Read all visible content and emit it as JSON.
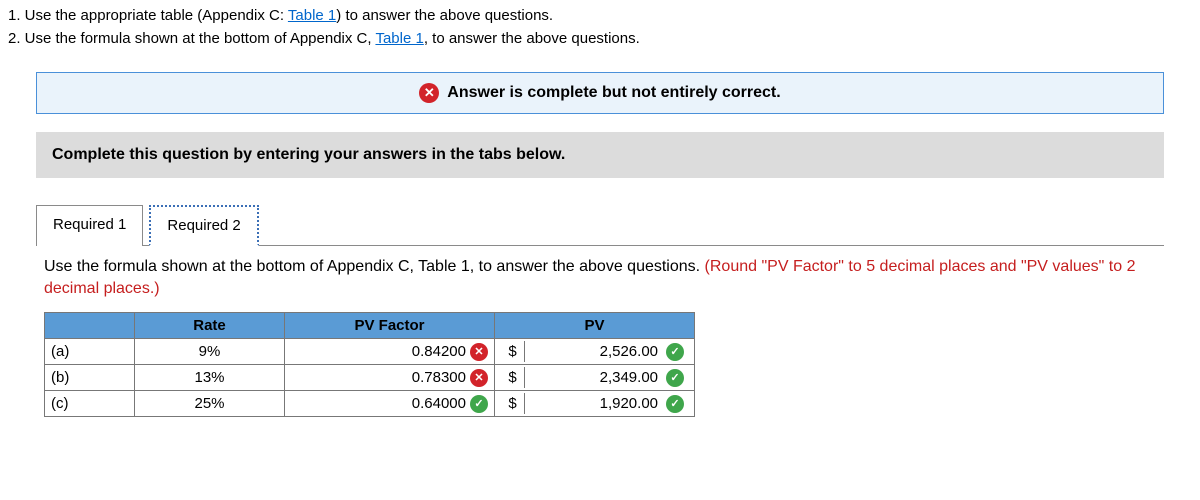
{
  "instructions": {
    "line1_prefix": "1. Use the appropriate table (Appendix C: ",
    "line1_link": "Table 1",
    "line1_suffix": ") to answer the above questions.",
    "line2_prefix": "2. Use the formula shown at the bottom of Appendix C, ",
    "line2_link": "Table 1",
    "line2_suffix": ", to answer the above questions."
  },
  "status": {
    "text": "Answer is complete but not entirely correct."
  },
  "complete_bar": "Complete this question by entering your answers in the tabs below.",
  "tabs": {
    "t1": "Required 1",
    "t2": "Required 2"
  },
  "panel": {
    "instr_main": "Use the formula shown at the bottom of Appendix C, Table 1, to answer the above questions. ",
    "instr_hint": "(Round \"PV Factor\" to 5 decimal places and \"PV values\" to 2 decimal places.)"
  },
  "table": {
    "headers": {
      "blank": "",
      "rate": "Rate",
      "pvf": "PV Factor",
      "pv": "PV"
    },
    "rows": [
      {
        "label": "(a)",
        "rate": "9%",
        "pvf": "0.84200",
        "pvf_ok": false,
        "pv": "2,526.00",
        "pv_ok": true
      },
      {
        "label": "(b)",
        "rate": "13%",
        "pvf": "0.78300",
        "pvf_ok": false,
        "pv": "2,349.00",
        "pv_ok": true
      },
      {
        "label": "(c)",
        "rate": "25%",
        "pvf": "0.64000",
        "pvf_ok": true,
        "pv": "1,920.00",
        "pv_ok": true
      }
    ],
    "currency": "$"
  }
}
